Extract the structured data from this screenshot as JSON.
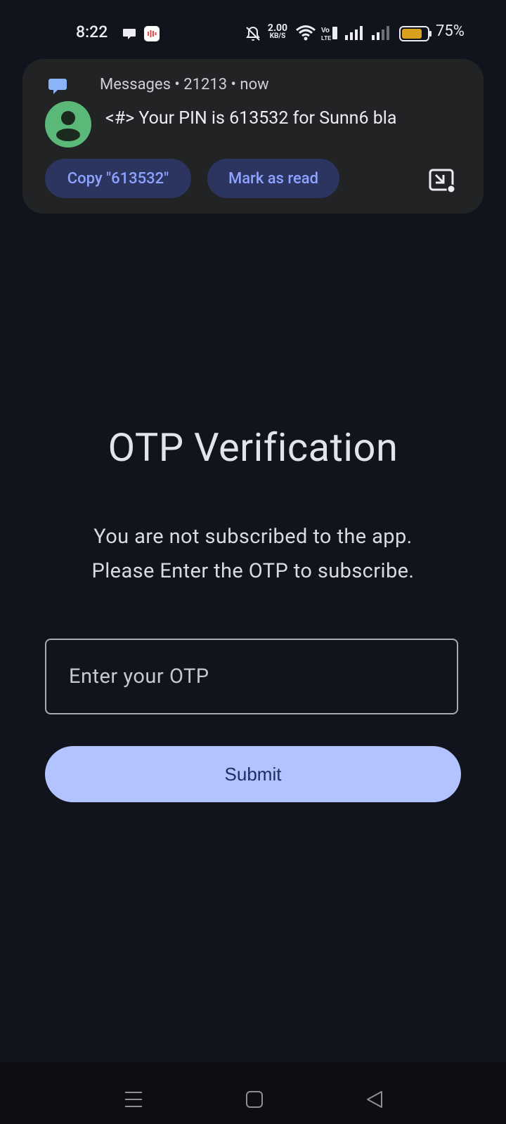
{
  "status_bar": {
    "time": "8:22",
    "net_speed_value": "2.00",
    "net_speed_unit": "KB/S",
    "battery_percent": "75%",
    "icons": [
      "chat-bubble-icon",
      "recorder-app-icon",
      "mute-bell-icon",
      "wifi-icon",
      "volte-icon",
      "signal-icon-1",
      "signal-icon-2",
      "battery-icon"
    ]
  },
  "notification": {
    "app_name": "Messages",
    "sender": "21213",
    "time": "now",
    "header": "Messages • 21213 • now",
    "body": "<#> Your PIN is 613532 for Sunn6 bla",
    "actions": {
      "copy_label": "Copy \"613532\"",
      "mark_read_label": "Mark as read"
    }
  },
  "main": {
    "title": "OTP Verification",
    "subtitle_line1": "You are not subscribed to the app.",
    "subtitle_line2": "Please Enter the OTP to subscribe.",
    "otp_placeholder": "Enter your OTP",
    "otp_value": "",
    "submit_label": "Submit"
  },
  "colors": {
    "background": "#11141c",
    "notification_bg": "#222325",
    "chip_bg": "#2b3560",
    "chip_text": "#8ea2ff",
    "button_bg": "#b3c3ff",
    "button_text": "#1e2c5e",
    "avatar": "#5ab878",
    "battery_fill": "#d8a01c"
  },
  "nav_bar": {
    "buttons": [
      "menu-icon",
      "home-icon",
      "back-icon"
    ]
  }
}
